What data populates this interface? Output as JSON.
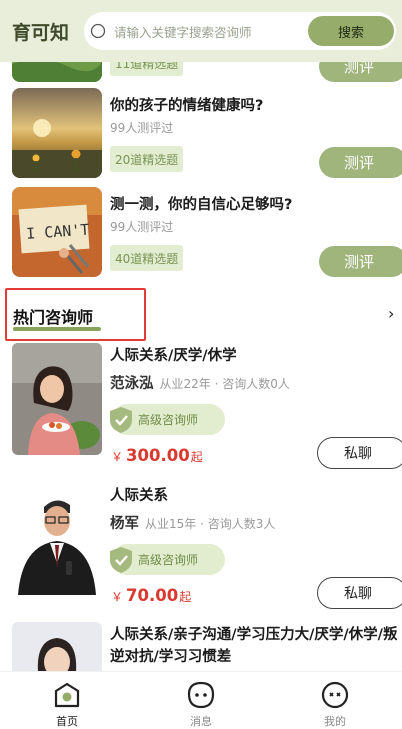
{
  "header": {
    "brand": "育可知",
    "search_placeholder": "请输入关键字搜索咨询师",
    "search_button": "搜索"
  },
  "tests": [
    {
      "title": "",
      "count": "",
      "tag": "11道精选题",
      "button": "测评",
      "image": "landscape-photo"
    },
    {
      "title": "你的孩子的情绪健康吗?",
      "count": "99人测评过",
      "tag": "20道精选题",
      "button": "测评",
      "image": "sunset-flower-photo"
    },
    {
      "title": "测一测，你的自信心足够吗?",
      "count": "99人测评过",
      "tag": "40道精选题",
      "button": "测评",
      "image": "i-cant-note-photo"
    }
  ],
  "section": {
    "title": "热门咨询师",
    "arrow": "›"
  },
  "consultants": [
    {
      "tags": "人际关系/厌学/休学",
      "name": "范泳泓",
      "meta": "从业22年 · 咨询人数0人",
      "level": "高级咨询师",
      "yen": "￥",
      "price": "300.00",
      "from": "起",
      "chat": "私聊"
    },
    {
      "tags": "人际关系",
      "name": "杨军",
      "meta": "从业15年 · 咨询人数3人",
      "level": "高级咨询师",
      "yen": "￥",
      "price": "70.00",
      "from": "起",
      "chat": "私聊"
    },
    {
      "tags": "人际关系/亲子沟通/学习压力大/厌学/休学/叛逆对抗/学习习惯差"
    }
  ],
  "tabbar": [
    {
      "label": "首页",
      "icon": "home-icon",
      "active": true
    },
    {
      "label": "消息",
      "icon": "message-icon",
      "active": false
    },
    {
      "label": "我的",
      "icon": "profile-icon",
      "active": false
    }
  ],
  "colors": {
    "header_bg": "#e9eedb",
    "accent_green": "#95ac6b",
    "price_red": "#d93a2f",
    "highlight_red": "#e23b36"
  }
}
